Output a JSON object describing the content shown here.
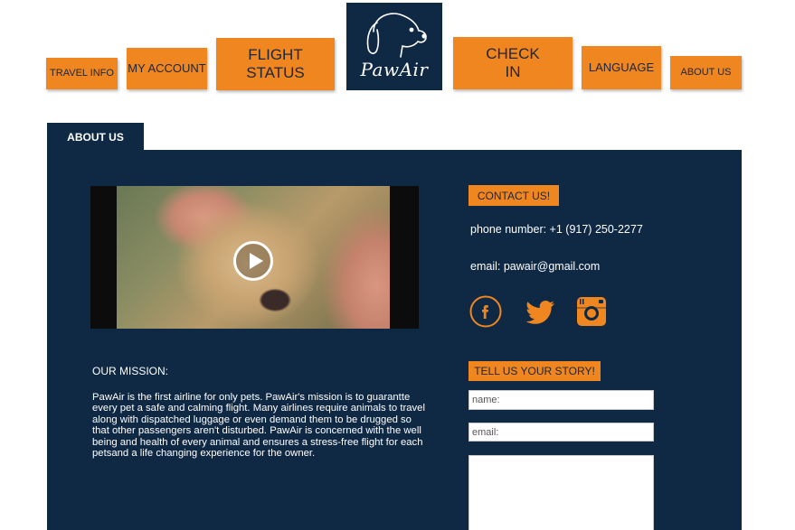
{
  "nav": {
    "travel_info": "TRAVEL INFO",
    "my_account": "MY ACCOUNT",
    "flight_status_line1": "FLIGHT",
    "flight_status_line2": "STATUS",
    "check_in_line1": "CHECK",
    "check_in_line2": "IN",
    "language": "LANGUAGE",
    "about_us": "ABOUT US"
  },
  "logo": {
    "text": "PawAir",
    "icon": "dog-head-icon"
  },
  "tab": {
    "label": "ABOUT US"
  },
  "video": {
    "icon": "play-icon"
  },
  "mission": {
    "heading": "OUR MISSION:",
    "text": "PawAir is the first airline for only pets. PawAir's mission is to guarantte every pet a safe and calming flight. Many airlines require animals to travel along with dispatched luggage or even demand them to be drugged so that other passengers aren't disturbed. PawAir is concerned with the well being and health of every animal and ensures a stress-free flight for each petsand a life changing experience for the owner."
  },
  "contact": {
    "button_label": "CONTACT US!",
    "phone": "phone number:  +1 (917) 250-2277",
    "email": "email:  pawair@gmail.com",
    "social": [
      "facebook-icon",
      "twitter-icon",
      "instagram-icon"
    ]
  },
  "story_form": {
    "heading": "TELL US YOUR STORY!",
    "name_placeholder": "name:",
    "email_placeholder": "email:",
    "story_placeholder": ""
  },
  "colors": {
    "accent": "#f0861f",
    "panel": "#0f2945",
    "text_on_accent": "#1b2638"
  }
}
